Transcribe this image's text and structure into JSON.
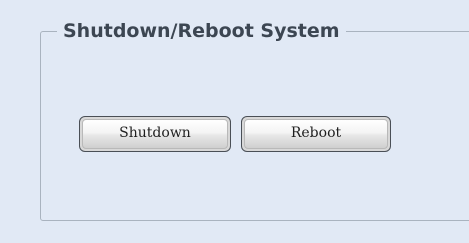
{
  "panel": {
    "legend": "Shutdown/Reboot System"
  },
  "actions": {
    "shutdown_label": "Shutdown",
    "reboot_label": "Reboot"
  }
}
